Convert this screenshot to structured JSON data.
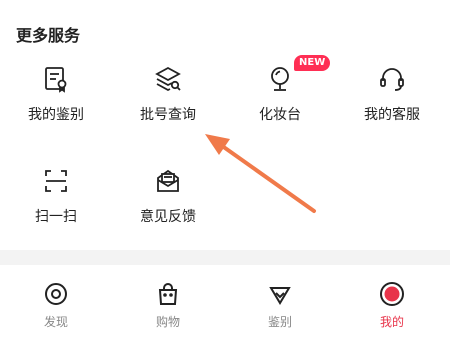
{
  "section": {
    "title": "更多服务"
  },
  "services": [
    {
      "label": "我的鉴别",
      "icon": "certificate-icon"
    },
    {
      "label": "批号查询",
      "icon": "layers-search-icon"
    },
    {
      "label": "化妆台",
      "icon": "mirror-icon",
      "badge": "NEW"
    },
    {
      "label": "我的客服",
      "icon": "headset-icon"
    },
    {
      "label": "扫一扫",
      "icon": "scan-icon"
    },
    {
      "label": "意见反馈",
      "icon": "feedback-icon"
    }
  ],
  "tabs": [
    {
      "label": "发现",
      "icon": "discover-icon"
    },
    {
      "label": "购物",
      "icon": "shopping-bag-icon"
    },
    {
      "label": "鉴别",
      "icon": "diamond-icon"
    },
    {
      "label": "我的",
      "icon": "profile-icon",
      "active": true
    }
  ],
  "colors": {
    "accent": "#e8344a",
    "badge": "#ff2e54",
    "annotation_arrow": "#f07a4a"
  }
}
